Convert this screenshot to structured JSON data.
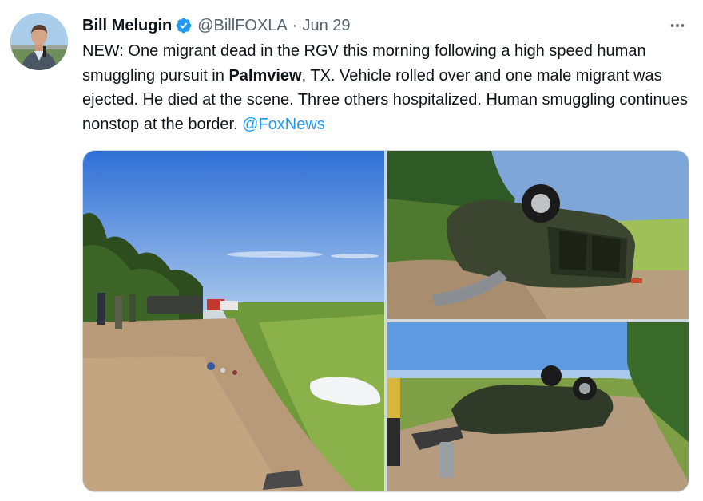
{
  "tweet": {
    "author_name": "Bill Melugin",
    "handle": "@BillFOXLA",
    "separator": "·",
    "date": "Jun 29",
    "text_segments": [
      {
        "text": "NEW: One migrant dead in the RGV this morning following a high speed human smuggling pursuit in ",
        "style": "normal"
      },
      {
        "text": "Palmview",
        "style": "bold"
      },
      {
        "text": ", TX. Vehicle rolled over and one male migrant was ejected. He died at the scene. Three others hospitalized. Human smuggling continues nonstop at the border. ",
        "style": "normal"
      },
      {
        "text": "@FoxNews",
        "style": "mention"
      }
    ]
  },
  "media": {
    "photo_count": 3
  },
  "icons": {
    "verified": "verified-badge-icon",
    "more": "more-options-icon"
  },
  "colors": {
    "text_primary": "#0f1419",
    "text_secondary": "#536471",
    "accent": "#1d9bf0",
    "border": "#cfd9de"
  }
}
